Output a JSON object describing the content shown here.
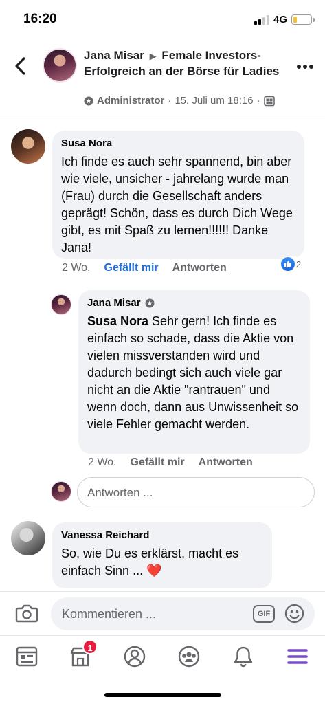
{
  "status_bar": {
    "time": "16:20",
    "network": "4G",
    "signal_bars": 2,
    "battery_level": 0.15
  },
  "header": {
    "author": "Jana Misar",
    "separator": "▶",
    "group": "Female Investors- Erfolgreich an der Börse für Ladies",
    "role": "Administrator",
    "dot": "·",
    "date": "15. Juli um 18:16",
    "icons": [
      "back-chevron-icon",
      "admin-badge-icon",
      "group-privacy-icon",
      "more-dots-icon"
    ]
  },
  "comments": [
    {
      "author": "Susa Nora",
      "text": "Ich finde es auch sehr spannend, bin aber wie viele, unsicher - jahrelang wurde man (Frau) durch die Gesellschaft anders geprägt! Schön, dass es durch Dich Wege gibt, es mit Spaß zu lernen!!!!!! Danke Jana!",
      "time": "2 Wo.",
      "like_label": "Gefällt mir",
      "reply_label": "Antworten",
      "reaction_count": "2"
    },
    {
      "author": "Jana Misar",
      "mention": "Susa Nora",
      "text": " Sehr gern! Ich finde es einfach so schade, dass die Aktie von vielen missverstanden wird und dadurch bedingt sich auch viele gar nicht an die Aktie \"rantrauen\" und wenn doch, dann aus Unwissenheit so viele Fehler gemacht werden.",
      "time": "2 Wo.",
      "like_label": "Gefällt mir",
      "reply_label": "Antworten"
    },
    {
      "author": "Vanessa Reichard",
      "text": "So, wie Du es erklärst, macht es einfach Sinn ... ❤️"
    }
  ],
  "reply_box": {
    "placeholder": "Antworten ..."
  },
  "composer": {
    "placeholder": "Kommentieren ...",
    "gif_label": "GIF"
  },
  "tabbar": {
    "items": [
      "news-feed-icon",
      "marketplace-icon",
      "profile-icon",
      "groups-icon",
      "notifications-icon",
      "menu-icon"
    ],
    "badge": "1"
  },
  "colors": {
    "accent": "#216fdb",
    "badge": "#e41e3f",
    "menu_active": "#7b4cc9",
    "bubble": "#f0f2f5"
  }
}
